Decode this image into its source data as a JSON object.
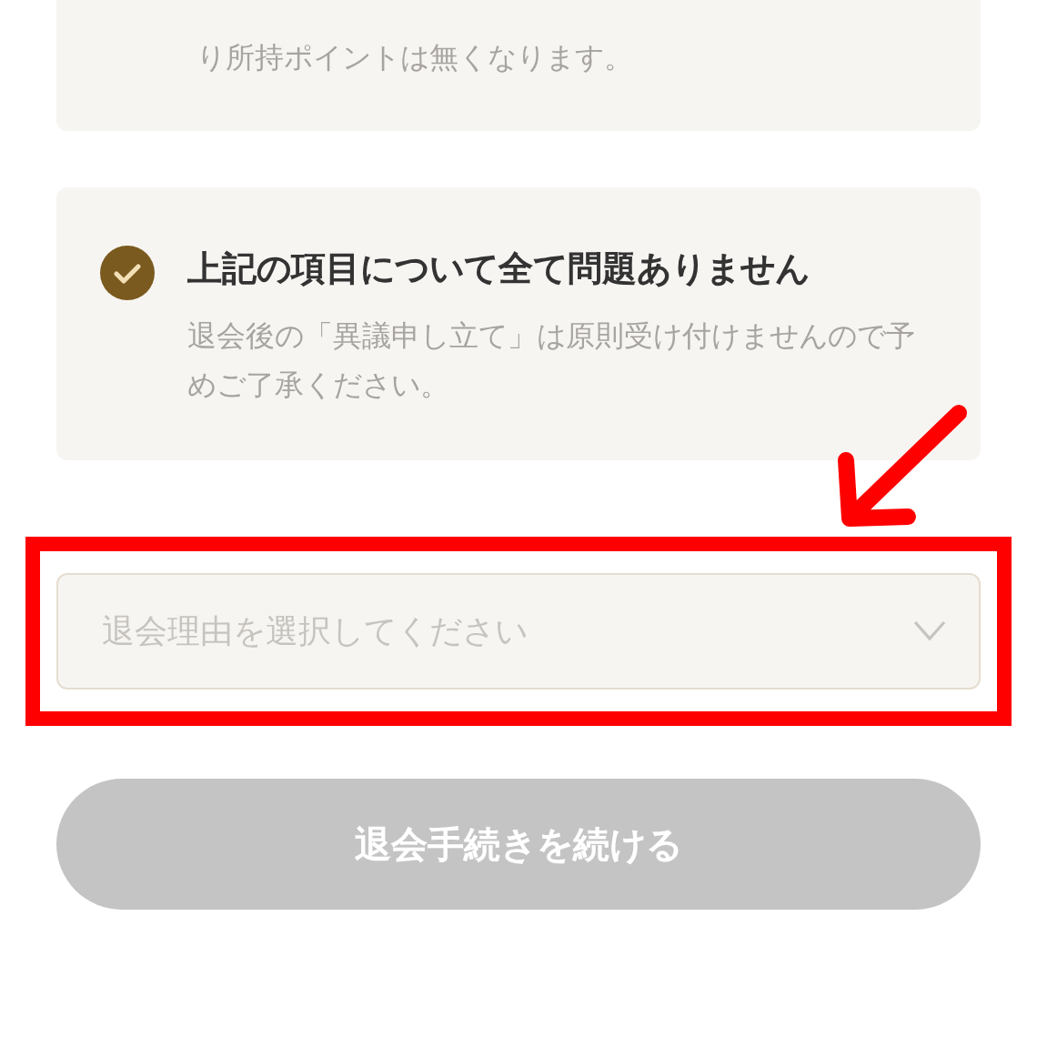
{
  "notice_card": {
    "text": "り所持ポイントは無くなります。"
  },
  "confirm_card": {
    "checked": true,
    "title": "上記の項目について全て問題ありません",
    "note": "退会後の「異議申し立て」は原則受け付けませんので予めご了承ください。"
  },
  "reason_select": {
    "placeholder": "退会理由を選択してください"
  },
  "continue_button": {
    "label": "退会手続きを続ける",
    "disabled": true
  }
}
